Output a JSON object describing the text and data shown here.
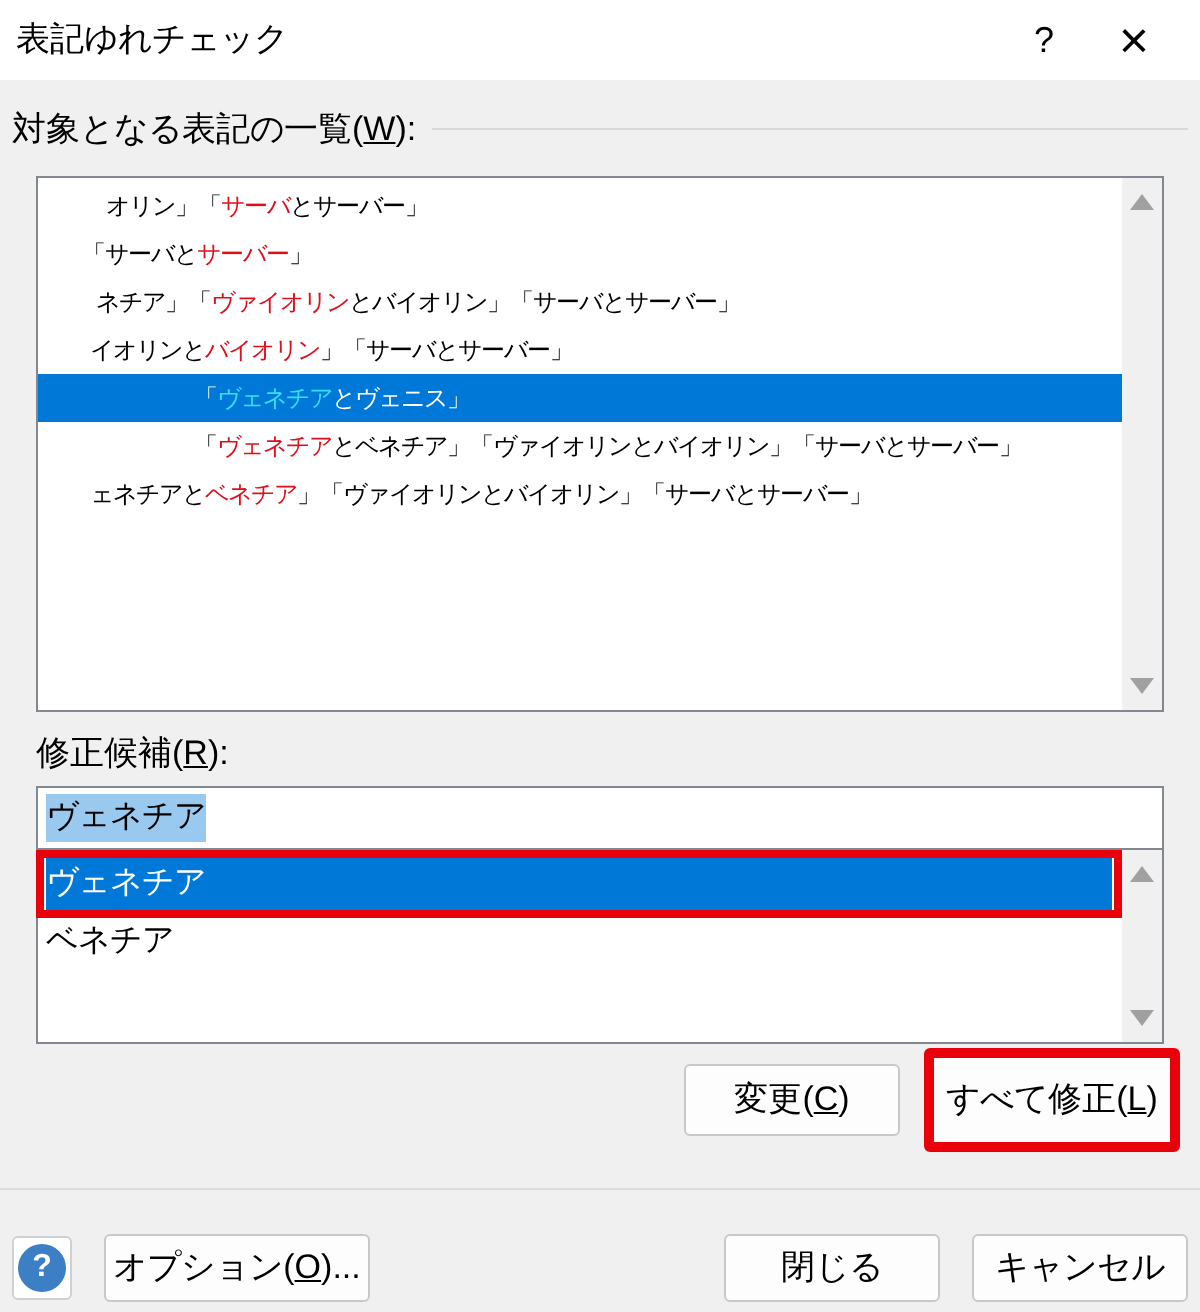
{
  "window": {
    "title": "表記ゆれチェック",
    "help_glyph": "?",
    "close_glyph": "×"
  },
  "list_label": [
    "対象となる表記の一覧(",
    "W",
    "):"
  ],
  "notations": [
    {
      "selected": false,
      "segments": [
        {
          "text": "オリン」「",
          "marked": false
        },
        {
          "text": "サーバ",
          "marked": true
        },
        {
          "text": "とサーバー」",
          "marked": false
        }
      ]
    },
    {
      "selected": false,
      "segments": [
        {
          "text": "「サーバと",
          "marked": false
        },
        {
          "text": "サーバー",
          "marked": true
        },
        {
          "text": "」",
          "marked": false
        }
      ]
    },
    {
      "selected": false,
      "segments": [
        {
          "text": "ネチア」「",
          "marked": false
        },
        {
          "text": "ヴァイオリン",
          "marked": true
        },
        {
          "text": "とバイオリン」「サーバとサーバー」",
          "marked": false
        }
      ]
    },
    {
      "selected": false,
      "segments": [
        {
          "text": "イオリンと",
          "marked": false
        },
        {
          "text": "バイオリン",
          "marked": true
        },
        {
          "text": "」「サーバとサーバー」",
          "marked": false
        }
      ]
    },
    {
      "selected": true,
      "segments": [
        {
          "text": "「",
          "marked": false
        },
        {
          "text": "ヴェネチア",
          "marked": true
        },
        {
          "text": "とヴェニス」",
          "marked": false
        }
      ]
    },
    {
      "selected": false,
      "segments": [
        {
          "text": "「",
          "marked": false
        },
        {
          "text": "ヴェネチア",
          "marked": true
        },
        {
          "text": "とベネチア」「ヴァイオリンとバイオリン」「サーバとサーバー」",
          "marked": false
        }
      ]
    },
    {
      "selected": false,
      "segments": [
        {
          "text": "ェネチアと",
          "marked": false
        },
        {
          "text": "ベネチア",
          "marked": true
        },
        {
          "text": "」「ヴァイオリンとバイオリン」「サーバとサーバー」",
          "marked": false
        }
      ]
    }
  ],
  "candidate_label": [
    "修正候補(",
    "R",
    "):"
  ],
  "candidate_value": "ヴェネチア",
  "candidates": [
    {
      "text": "ヴェネチア",
      "selected": true,
      "annotated": true
    },
    {
      "text": "ベネチア",
      "selected": false,
      "annotated": false
    }
  ],
  "action_buttons": [
    {
      "parts": [
        "変更(",
        "C",
        ")"
      ],
      "annotated": false
    },
    {
      "parts": [
        "すべて修正(",
        "L",
        ")"
      ],
      "annotated": true
    }
  ],
  "help_button": "?",
  "footer_buttons": [
    {
      "parts": [
        "オプション(",
        "O",
        ")..."
      ]
    },
    {
      "parts": [
        "閉じる"
      ]
    },
    {
      "parts": [
        "キャンセル"
      ]
    }
  ]
}
